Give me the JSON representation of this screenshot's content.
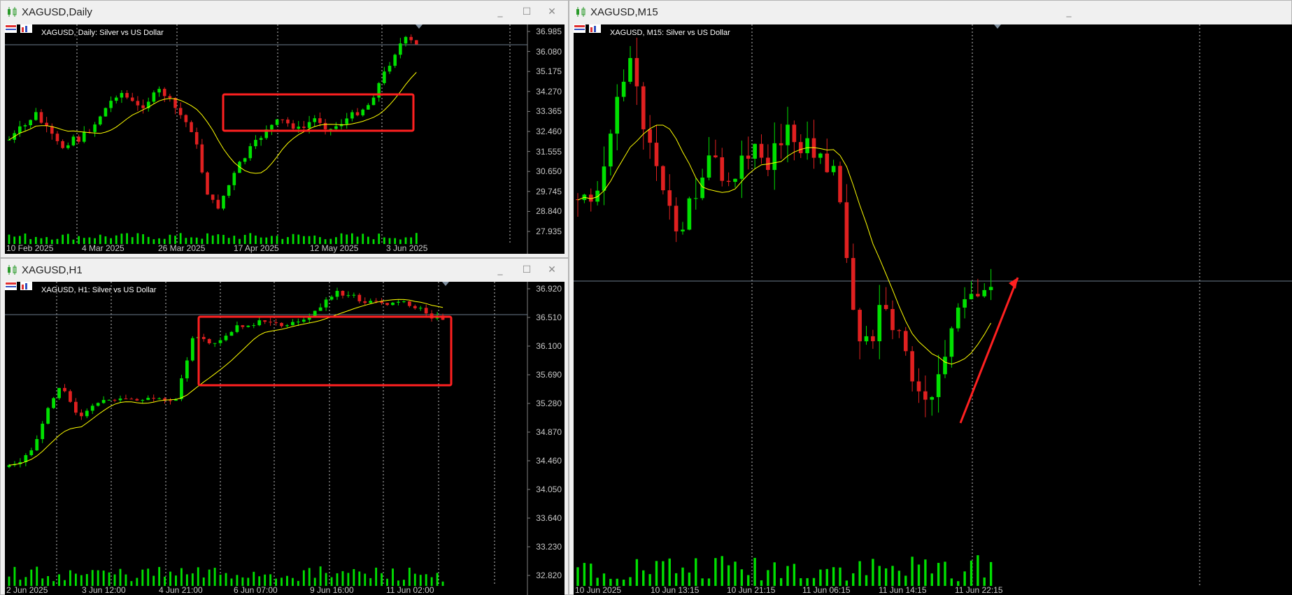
{
  "windows": {
    "daily": {
      "title": "XAGUSD,Daily",
      "chart_label": "XAGUSD, Daily:  Silver vs US Dollar",
      "current_price": "36.333",
      "price_axis": [
        "36.985",
        "36.080",
        "35.175",
        "34.270",
        "33.365",
        "32.460",
        "31.555",
        "30.650",
        "29.745",
        "28.840",
        "27.935"
      ],
      "date_axis": [
        "10 Feb 2025",
        "4 Mar 2025",
        "26 Mar 2025",
        "17 Apr 2025",
        "12 May 2025",
        "3 Jun 2025"
      ]
    },
    "h1": {
      "title": "XAGUSD,H1",
      "chart_label": "XAGUSD, H1:  Silver vs US Dollar",
      "current_price": "36.333",
      "price_axis": [
        "36.920",
        "36.510",
        "36.100",
        "35.690",
        "35.280",
        "34.870",
        "34.460",
        "34.050",
        "33.640",
        "33.230",
        "32.820"
      ],
      "date_axis": [
        "2 Jun 2025",
        "3 Jun 12:00",
        "4 Jun 21:00",
        "6 Jun 07:00",
        "9 Jun 16:00",
        "11 Jun 02:00"
      ]
    },
    "m15": {
      "title": "XAGUSD,M15",
      "chart_label": "XAGUSD, M15:  Silver vs US Dollar",
      "date_axis": [
        "10 Jun 2025",
        "10 Jun 13:15",
        "10 Jun 21:15",
        "11 Jun 06:15",
        "11 Jun 14:15",
        "11 Jun 22:15"
      ]
    }
  },
  "controls": {
    "minimize": "_",
    "maximize": "☐",
    "close": "✕"
  },
  "colors": {
    "bull": "#00e000",
    "bear": "#e02020",
    "ma": "#ffff00",
    "highlight": "#ff2020",
    "grid": "#c0c0c0"
  },
  "icons": [
    "chart-symbol-icon",
    "window-minimize-icon",
    "window-maximize-icon",
    "window-close-icon"
  ]
}
